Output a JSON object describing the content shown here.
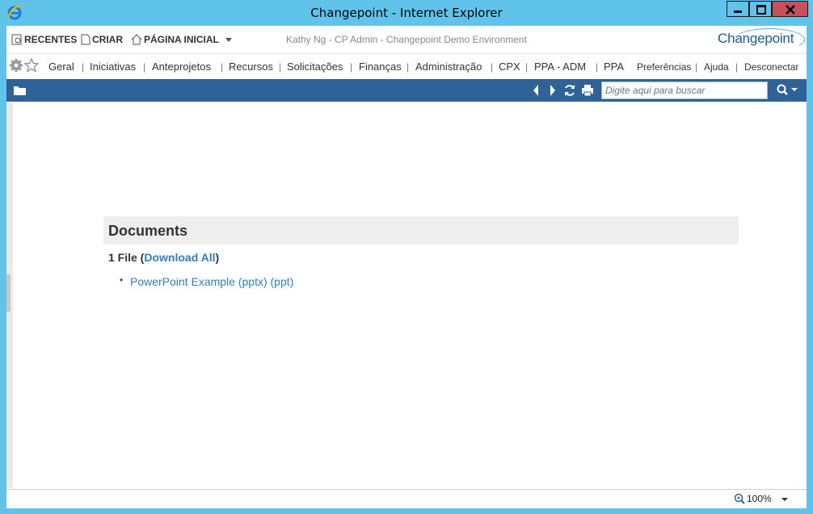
{
  "window": {
    "title": "Changepoint - Internet Explorer"
  },
  "topbar": {
    "recent_label": "RECENTES",
    "create_label": "CRIAR",
    "home_label": "PÁGINA INICIAL",
    "user_info": "Kathy Ng - CP Admin - Changepoint Demo Environment",
    "logo_text": "Changepoint"
  },
  "nav": {
    "items": [
      "Geral",
      "Iniciativas",
      "Anteprojetos",
      "Recursos",
      "Solicitações",
      "Finanças",
      "Administração",
      "CPX",
      "PPA - ADM",
      "PPA",
      "Preferências",
      "Ajuda",
      "Desconectar"
    ]
  },
  "toolbar": {
    "search_placeholder": "Digite aqui para buscar"
  },
  "documents": {
    "title": "Documents",
    "file_count_prefix": "1 File (",
    "download_all": "Download All",
    "file_count_suffix": ")",
    "files": [
      "PowerPoint Example (pptx) (ppt)"
    ]
  },
  "statusbar": {
    "zoom": "100%"
  },
  "colors": {
    "window_frame": "#5fc3ea",
    "toolbar_blue": "#2f6296",
    "link_blue": "#2f7fc1",
    "close_red": "#c7505a"
  },
  "icons": [
    "ie-logo-icon",
    "recent-icon",
    "create-icon",
    "home-icon",
    "chevron-down-icon",
    "gear-icon",
    "star-icon",
    "folder-icon",
    "back-arrow-icon",
    "forward-arrow-icon",
    "refresh-icon",
    "print-icon",
    "search-icon",
    "zoom-icon"
  ]
}
